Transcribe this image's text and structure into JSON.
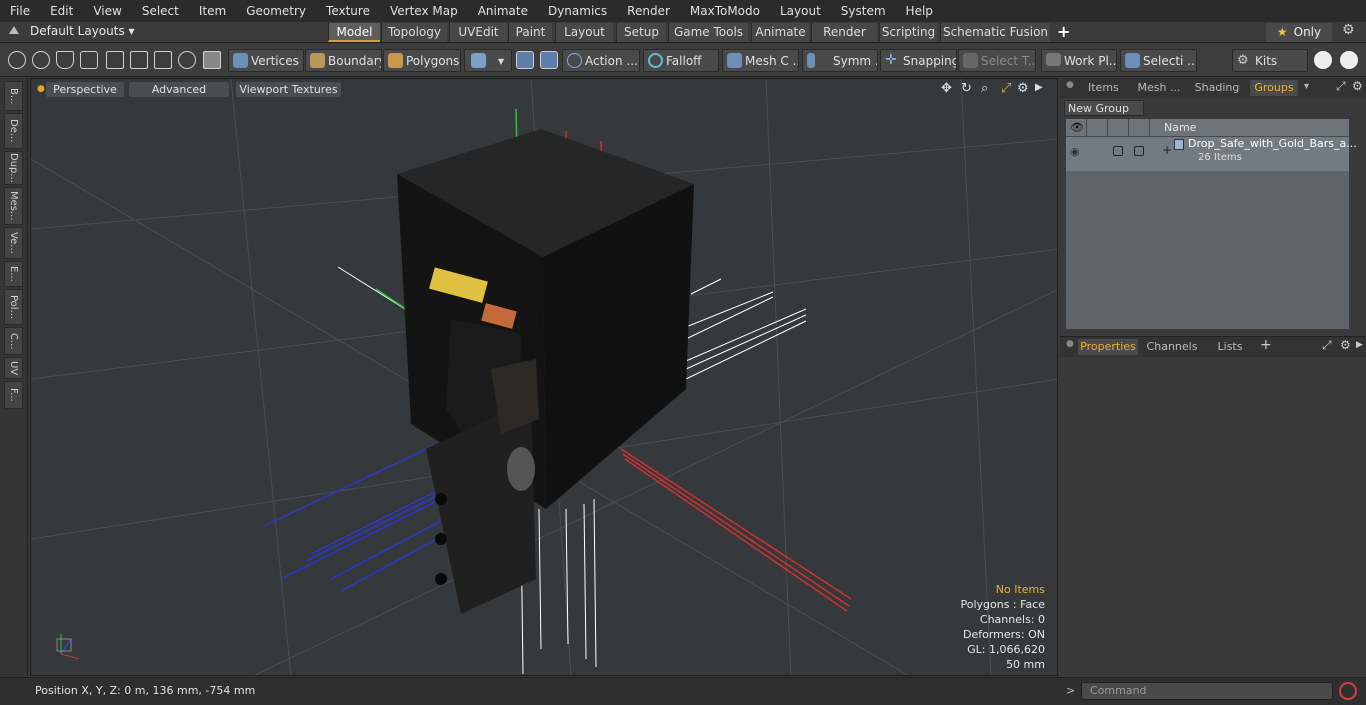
{
  "menu": [
    "File",
    "Edit",
    "View",
    "Select",
    "Item",
    "Geometry",
    "Texture",
    "Vertex Map",
    "Animate",
    "Dynamics",
    "Render",
    "MaxToModo",
    "Layout",
    "System",
    "Help"
  ],
  "layout_selector": "Default Layouts",
  "tabs": [
    "Model",
    "Topology",
    "UVEdit",
    "Paint",
    "Layout",
    "Setup",
    "Game Tools",
    "Animate",
    "Render",
    "Scripting",
    "Schematic Fusion"
  ],
  "active_tab": "Model",
  "only_label": "Only",
  "toolbar": {
    "vertices": "Vertices",
    "boundary": "Boundary",
    "polygons": "Polygons",
    "action": "Action ...",
    "falloff": "Falloff",
    "mesh": "Mesh C ...",
    "symm": "Symm ...",
    "snapping": "Snapping",
    "select_t": "Select T...",
    "work_pl": "Work Pl...",
    "selecti": "Selecti ...",
    "kits": "Kits"
  },
  "left_tools": [
    "B...",
    "De...",
    "Dup...",
    "Mes...",
    "Ve...",
    "E...",
    "Pol...",
    "C...",
    "UV",
    "F..."
  ],
  "viewport": {
    "perspective": "Perspective",
    "advanced": "Advanced",
    "textures": "Viewport Textures",
    "status": {
      "items": "No Items",
      "polygons": "Polygons : Face",
      "channels": "Channels: 0",
      "deformers": "Deformers: ON",
      "gl": "GL: 1,066,620",
      "scale": "50 mm"
    }
  },
  "right_panel": {
    "tabs": [
      "Items",
      "Mesh ...",
      "Shading",
      "Groups"
    ],
    "active_tab": "Groups",
    "new_group": "New Group",
    "col_name": "Name",
    "group_name": "Drop_Safe_with_Gold_Bars_a...",
    "group_count": "26 Items",
    "prop_tabs": [
      "Properties",
      "Channels",
      "Lists"
    ],
    "active_prop_tab": "Properties"
  },
  "bottom": {
    "position": "Position X, Y, Z:   0 m, 136 mm, -754 mm",
    "command_placeholder": "Command"
  },
  "colors": {
    "accent": "#e8b32c",
    "viewport_bg": "#36393b",
    "panel": "#3a3a3a"
  }
}
